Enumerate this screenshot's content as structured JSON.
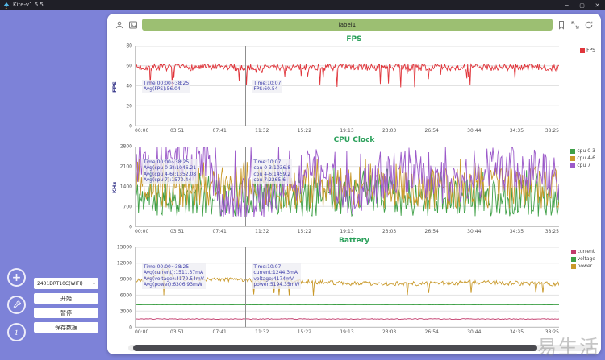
{
  "window": {
    "title": "Kite-v1.5.5",
    "minimize": "─",
    "maximize": "▢",
    "close": "✕"
  },
  "toolbar": {
    "label_value": "label1"
  },
  "controls": {
    "device": "2401DRT10C(WIFI)",
    "caret": "▾",
    "fab_plus": "+",
    "fab_info": "i",
    "buttons": [
      {
        "label": "开始"
      },
      {
        "label": "暂停"
      },
      {
        "label": "保存数据"
      }
    ]
  },
  "watermark": {
    "text": "易生活"
  },
  "chart_data": [
    {
      "type": "line",
      "title": "FPS",
      "ylabel": "FPS",
      "ylim": [
        0,
        80
      ],
      "yticks": [
        0,
        20,
        40,
        60,
        80
      ],
      "xticks": [
        "00:00",
        "03:51",
        "07:41",
        "11:32",
        "15:22",
        "19:13",
        "23:03",
        "26:54",
        "30:44",
        "34:35",
        "38:25"
      ],
      "grid": true,
      "legend_position": "right",
      "legend": [
        {
          "name": "FPS",
          "color": "#e0353b"
        }
      ],
      "series": [
        {
          "name": "FPS",
          "color": "#e0353b",
          "avg": 56.04,
          "gen": {
            "seed": 7,
            "n": 520,
            "base": 58.5,
            "jitter": 3.5,
            "min": 36,
            "max": 61.5,
            "dip_chance": 0.06,
            "dip_min": 38,
            "dip_max": 54
          }
        }
      ],
      "cursor": {
        "x_frac": 0.26,
        "time": "10:07"
      },
      "tooltips": {
        "range": {
          "x_frac": 0.015,
          "y_frac": 0.42,
          "lines": [
            "Time:00:00~38:25",
            "Avg(FPS):56.04"
          ]
        },
        "cursor": {
          "x_frac": 0.275,
          "y_frac": 0.42,
          "lines": [
            "Time:10:07",
            "FPS:60.54"
          ]
        }
      }
    },
    {
      "type": "line",
      "title": "CPU Clock",
      "ylabel": "KHz",
      "ylim": [
        0,
        2800
      ],
      "yticks": [
        0,
        700,
        1400,
        2100,
        2800
      ],
      "xticks": [
        "00:00",
        "03:51",
        "07:41",
        "11:32",
        "15:22",
        "19:13",
        "23:03",
        "26:54",
        "30:44",
        "34:35",
        "38:25"
      ],
      "grid": true,
      "legend_position": "right",
      "legend": [
        {
          "name": "cpu 0-3",
          "color": "#3fa047"
        },
        {
          "name": "cpu 4-6",
          "color": "#c9992a"
        },
        {
          "name": "cpu 7",
          "color": "#9b59c9"
        }
      ],
      "series": [
        {
          "name": "cpu 0-3",
          "color": "#3fa047",
          "gen": {
            "seed": 11,
            "n": 430,
            "base": 1000,
            "jitter": 650,
            "min": 290,
            "max": 2080,
            "spike_chance": 0.06,
            "spike_min": 1700,
            "spike_max": 2080
          }
        },
        {
          "name": "cpu 4-6",
          "color": "#c9992a",
          "gen": {
            "seed": 12,
            "n": 430,
            "base": 1350,
            "jitter": 750,
            "min": 430,
            "max": 2380,
            "spike_chance": 0.05,
            "spike_min": 2000,
            "spike_max": 2380
          }
        },
        {
          "name": "cpu 7",
          "color": "#9b59c9",
          "gen": {
            "seed": 13,
            "n": 430,
            "jitter": 800,
            "min": 320,
            "max": 2800,
            "spike_chance": 0.08,
            "spike_min": 2500,
            "spike_max": 2800,
            "envelope": [
              [
                0,
                2350
              ],
              [
                0.17,
                2350
              ],
              [
                0.2,
                900
              ],
              [
                0.3,
                1000
              ],
              [
                0.42,
                1900
              ],
              [
                0.5,
                1100
              ],
              [
                0.62,
                1900
              ],
              [
                0.75,
                1400
              ],
              [
                0.88,
                2100
              ],
              [
                1,
                1700
              ]
            ]
          }
        }
      ],
      "cursor": {
        "x_frac": 0.26,
        "time": "10:07"
      },
      "tooltips": {
        "range": {
          "x_frac": 0.015,
          "y_frac": 0.15,
          "lines": [
            "Time:00:00~38:25",
            "Avg(cpu 0-3):1046.21",
            "Avg(cpu 4-6):1352.08",
            "Avg(cpu 7):1570.44"
          ]
        },
        "cursor": {
          "x_frac": 0.275,
          "y_frac": 0.15,
          "lines": [
            "Time:10:07",
            "cpu 0-3:1036.8",
            "cpu 4-6:1459.2",
            "cpu 7:2265.6"
          ]
        }
      }
    },
    {
      "type": "line",
      "title": "Battery",
      "ylabel": "",
      "ylim": [
        0,
        15000
      ],
      "yticks": [
        0,
        3000,
        6000,
        9000,
        12000,
        15000
      ],
      "xticks": [
        "00:00",
        "03:51",
        "07:41",
        "11:32",
        "15:22",
        "19:13",
        "23:03",
        "26:54",
        "30:44",
        "34:35",
        "38:25"
      ],
      "grid": true,
      "legend_position": "right",
      "legend": [
        {
          "name": "current",
          "color": "#c23a6b"
        },
        {
          "name": "voltage",
          "color": "#3fa047"
        },
        {
          "name": "power",
          "color": "#c9992a"
        }
      ],
      "series": [
        {
          "name": "power",
          "color": "#c9992a",
          "avg": 6306.93,
          "gen": {
            "seed": 21,
            "n": 420,
            "jitter": 420,
            "min": 5800,
            "max": 11800,
            "dip_chance": 0.04,
            "dip_min": 5900,
            "dip_max": 6600,
            "envelope": [
              [
                0,
                8600
              ],
              [
                0.04,
                9300
              ],
              [
                0.07,
                11200
              ],
              [
                0.09,
                9200
              ],
              [
                0.2,
                8900
              ],
              [
                0.35,
                8700
              ],
              [
                0.5,
                8200
              ],
              [
                0.65,
                8100
              ],
              [
                0.8,
                8400
              ],
              [
                0.92,
                8200
              ],
              [
                1,
                8000
              ]
            ]
          }
        },
        {
          "name": "voltage",
          "color": "#3fa047",
          "avg": 4170.54,
          "gen": {
            "seed": 22,
            "n": 300,
            "base": 4170,
            "jitter": 14,
            "min": 4100,
            "max": 4240
          }
        },
        {
          "name": "current",
          "color": "#c23a6b",
          "avg": 1511.37,
          "gen": {
            "seed": 23,
            "n": 300,
            "base": 1500,
            "jitter": 70,
            "min": 1200,
            "max": 1900
          }
        }
      ],
      "cursor": {
        "x_frac": 0.26,
        "time": "10:07"
      },
      "tooltips": {
        "range": {
          "x_frac": 0.015,
          "y_frac": 0.2,
          "lines": [
            "Time:00:00~38:25",
            "Avg(current):1511.37mA",
            "Avg(voltage):4170.54mV",
            "Avg(power):6306.93mW"
          ]
        },
        "cursor": {
          "x_frac": 0.275,
          "y_frac": 0.2,
          "lines": [
            "Time:10:07",
            "current:1244.3mA",
            "voltage:4174mV",
            "power:5194.35mW"
          ]
        }
      }
    }
  ]
}
